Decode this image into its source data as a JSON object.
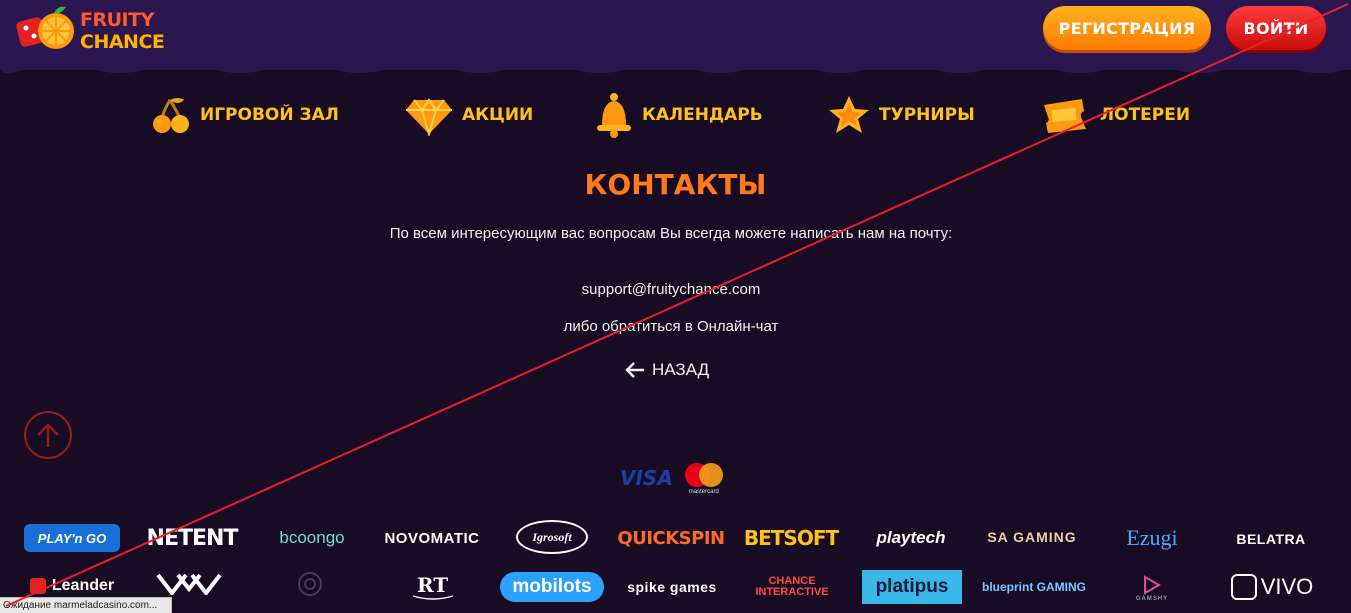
{
  "header": {
    "logo_line1": "FRUITY",
    "logo_line2": "CHANCE",
    "register_label": "РЕГИСТРАЦИЯ",
    "login_label": "ВОЙТИ"
  },
  "nav": {
    "items": [
      {
        "label": "ИГРОВОЙ ЗАЛ",
        "icon": "cherry-icon"
      },
      {
        "label": "АКЦИИ",
        "icon": "diamond-icon"
      },
      {
        "label": "КАЛЕНДАРЬ",
        "icon": "bell-icon"
      },
      {
        "label": "ТУРНИРЫ",
        "icon": "star-icon"
      },
      {
        "label": "ЛОТЕРЕИ",
        "icon": "ticket-icon"
      }
    ]
  },
  "content": {
    "title": "КОНТАКТЫ",
    "text1": "По всем интересующим вас вопросам Вы всегда можете написать нам на почту:",
    "email": "support@fruitychance.com",
    "text2": "либо обратиться в Онлайн-чат",
    "back_label": "НАЗАД"
  },
  "payments": {
    "visa": "VISA",
    "mastercard": "mastercard"
  },
  "providers": {
    "row1": [
      "PLAY'n GO",
      "NETENT",
      "bcoongo",
      "NOVOMATIC",
      "Igrosoft",
      "QUICKSPIN",
      "BETSOFT",
      "playtech",
      "SA GAMING",
      "Ezugi",
      "BELATRA"
    ],
    "row2": [
      "Leander",
      "mobilots",
      "spike games",
      "CHANCE INTERACTIVE",
      "platipus",
      "blueprint GAMING",
      "GAMSHY",
      "VIVO"
    ]
  },
  "status": {
    "text": "Ожидание marmeladcasino.com..."
  },
  "colors": {
    "background": "#180c24",
    "header": "#2b1650",
    "accent_orange": "#ff7a1a",
    "nav_yellow": "#ffc21a",
    "register": "#ff9a10",
    "login": "#e01818"
  }
}
